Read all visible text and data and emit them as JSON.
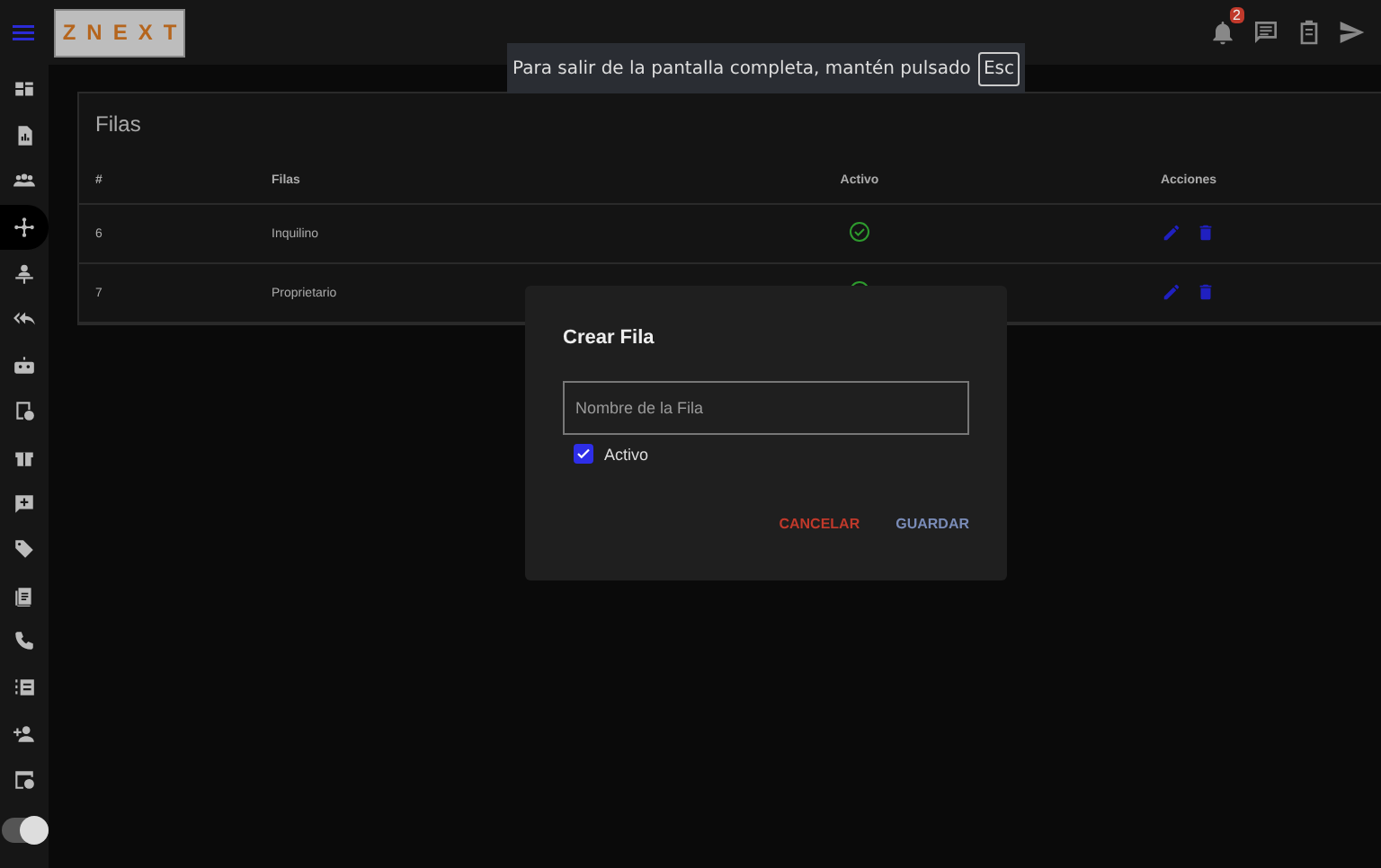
{
  "header": {
    "logo": "ZNEXT",
    "notifications": {
      "badge": "2"
    }
  },
  "sidebar": {
    "items": [
      {
        "selected": false
      },
      {
        "selected": false
      },
      {
        "selected": false
      },
      {
        "selected": true
      },
      {
        "selected": false
      },
      {
        "selected": false
      },
      {
        "selected": false
      },
      {
        "selected": false
      },
      {
        "selected": false
      },
      {
        "selected": false
      },
      {
        "selected": false
      },
      {
        "selected": false
      },
      {
        "selected": false
      },
      {
        "selected": false
      },
      {
        "selected": false
      },
      {
        "selected": false
      }
    ]
  },
  "theme_toggle": {
    "on": true
  },
  "fullscreen_notice": {
    "text": "Para salir de la pantalla completa, mantén pulsado",
    "key": "Esc"
  },
  "card": {
    "title": "Filas",
    "table": {
      "columns": [
        "#",
        "Filas",
        "Activo",
        "Acciones"
      ],
      "rows": [
        {
          "id": "6",
          "name": "Inquilino",
          "active": true
        },
        {
          "id": "7",
          "name": "Proprietario",
          "active": true
        }
      ]
    }
  },
  "dialog": {
    "title": "Crear Fila",
    "field": {
      "placeholder": "Nombre de la Fila"
    },
    "checkbox": {
      "label": "Activo",
      "checked": true
    },
    "buttons": [
      {
        "label": "CANCELAR",
        "kind": "cancel"
      },
      {
        "label": "GUARDAR",
        "kind": "save"
      }
    ]
  }
}
